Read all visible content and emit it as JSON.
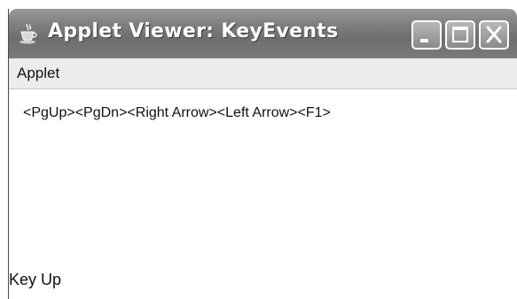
{
  "window": {
    "title": "Applet Viewer: KeyEvents",
    "icon": "java-cup-icon",
    "controls": [
      "minimize-icon",
      "maximize-icon",
      "close-icon"
    ]
  },
  "menubar": {
    "items": [
      {
        "label": "Applet"
      }
    ]
  },
  "applet": {
    "key_log": "<PgUp><PgDn><Right Arrow><Left Arrow><F1>",
    "status": "Key Up"
  },
  "colors": {
    "titlebar": "#7a7a7a",
    "title_text": "#ffffff",
    "menubar": "#ececec",
    "content": "#ffffff"
  }
}
